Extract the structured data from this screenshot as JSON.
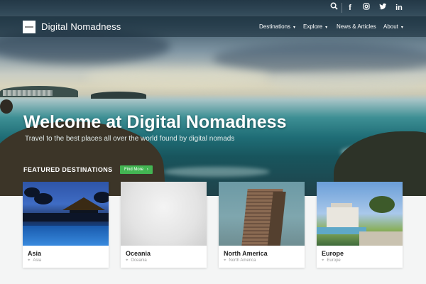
{
  "header": {
    "brand": "Digital Nomadness",
    "menu": [
      {
        "label": "Destinations",
        "caret": "▾"
      },
      {
        "label": "Explore",
        "caret": "▾"
      },
      {
        "label": "News & Articles",
        "caret": ""
      },
      {
        "label": "About",
        "caret": "▾"
      }
    ],
    "social": [
      "search-icon",
      "facebook-icon",
      "instagram-icon",
      "twitter-icon",
      "linkedin-icon"
    ]
  },
  "hero": {
    "title": "Welcome at Digital Nomadness",
    "subtitle": "Travel to the best places all over the world found by digital nomads"
  },
  "featured": {
    "heading": "FEATURED DESTINATIONS",
    "button": "Find More",
    "button_arrow": "›",
    "cards": [
      {
        "name": "Asia",
        "location": "Asia"
      },
      {
        "name": "Oceania",
        "location": "Oceania"
      },
      {
        "name": "North America",
        "location": "North America"
      },
      {
        "name": "Europe",
        "location": "Europe"
      }
    ]
  },
  "colors": {
    "accent_green": "#43b553",
    "nav_bg": "#142834"
  }
}
